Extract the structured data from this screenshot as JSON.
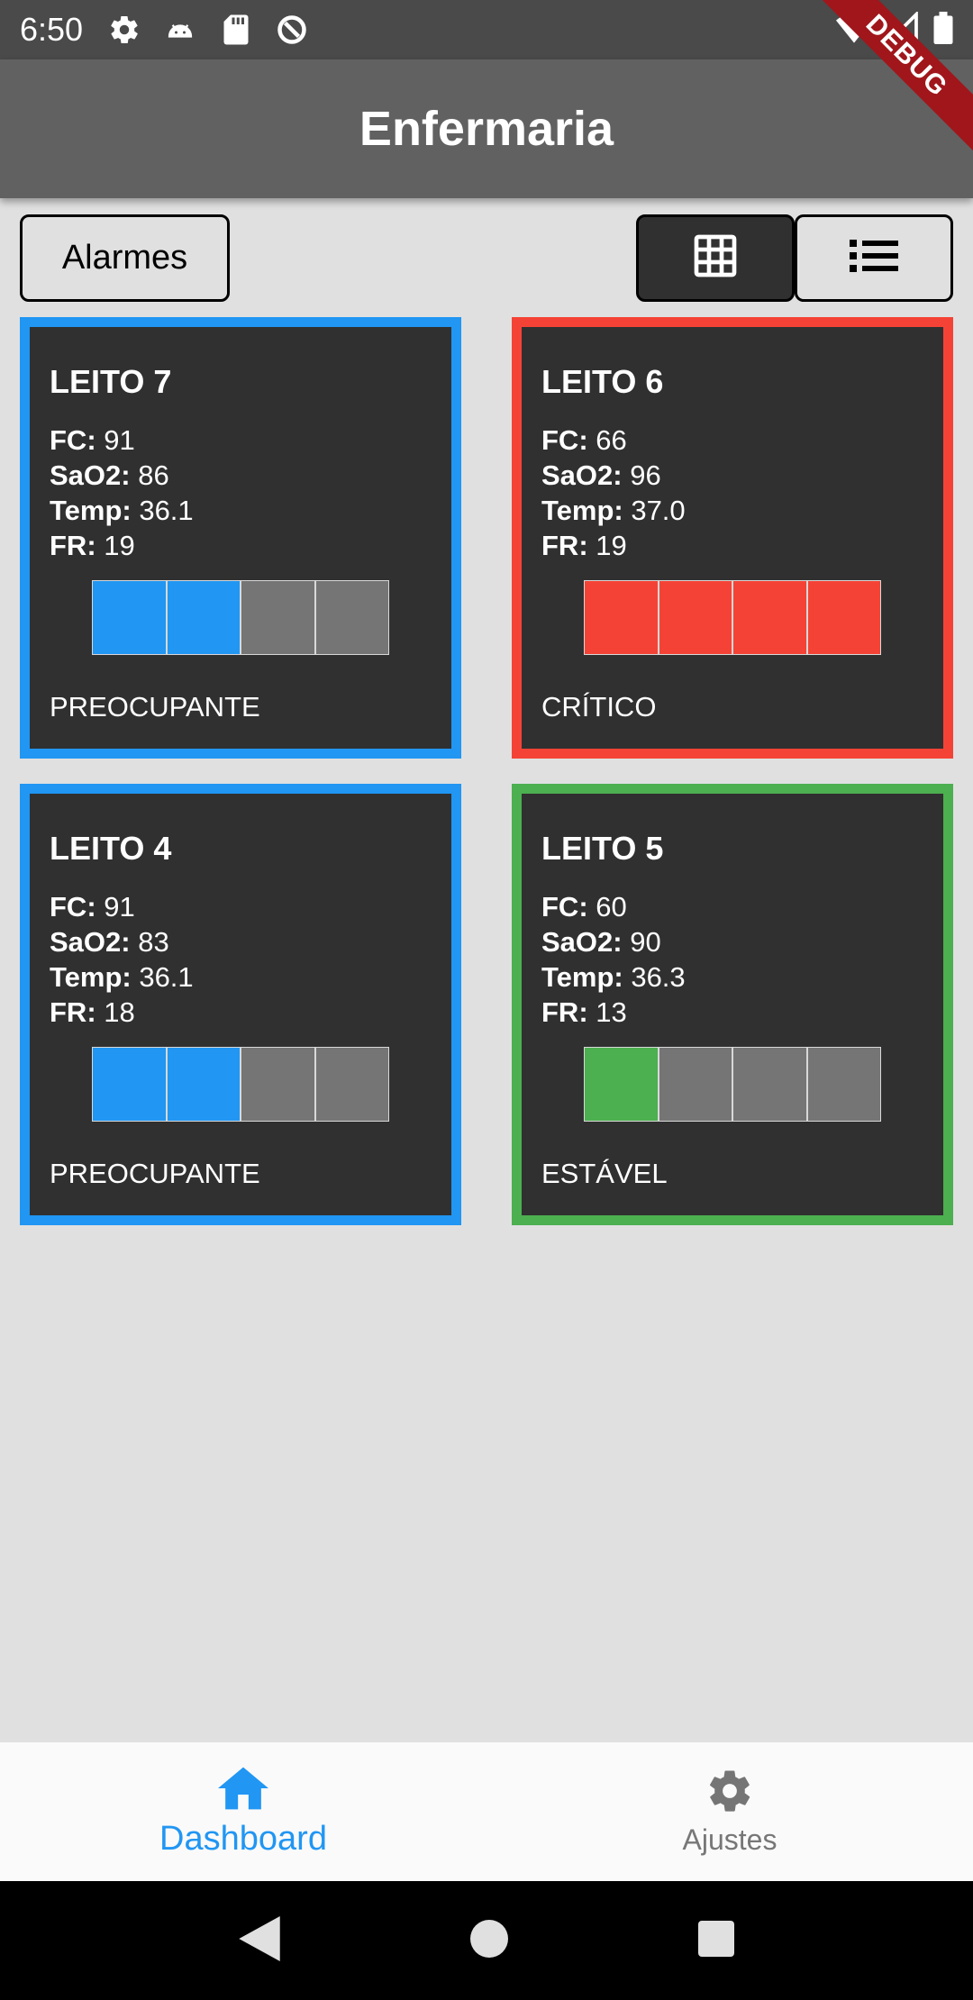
{
  "status_bar": {
    "time": "6:50",
    "icons": [
      "gear-icon",
      "android-icon",
      "sd-card-icon",
      "sync-icon"
    ],
    "right_icons": [
      "wifi-icon",
      "signal-icon",
      "battery-icon"
    ]
  },
  "debug_banner": "DEBUG",
  "app_bar": {
    "title": "Enfermaria"
  },
  "controls": {
    "alarms_label": "Alarmes",
    "grid_view_icon": "grid-icon",
    "list_view_icon": "list-icon"
  },
  "labels": {
    "fc": "FC:",
    "sao2": "SaO2:",
    "temp": "Temp:",
    "fr": "FR:"
  },
  "colors": {
    "preocupante": "#2196f3",
    "critico": "#f44336",
    "estavel": "#4caf50",
    "inactive_segment": "#757575",
    "card_bg": "#303030"
  },
  "beds": [
    {
      "name": "LEITO 7",
      "fc": "91",
      "sao2": "86",
      "temp": "36.1",
      "fr": "19",
      "status": "PREOCUPANTE",
      "level": 2,
      "color": "#2196f3"
    },
    {
      "name": "LEITO 6",
      "fc": "66",
      "sao2": "96",
      "temp": "37.0",
      "fr": "19",
      "status": "CRÍTICO",
      "level": 4,
      "color": "#f44336"
    },
    {
      "name": "LEITO 4",
      "fc": "91",
      "sao2": "83",
      "temp": "36.1",
      "fr": "18",
      "status": "PREOCUPANTE",
      "level": 2,
      "color": "#2196f3"
    },
    {
      "name": "LEITO 5",
      "fc": "60",
      "sao2": "90",
      "temp": "36.3",
      "fr": "13",
      "status": "ESTÁVEL",
      "level": 1,
      "color": "#4caf50"
    }
  ],
  "bottom_nav": {
    "items": [
      {
        "label": "Dashboard",
        "icon": "home-icon",
        "active": true
      },
      {
        "label": "Ajustes",
        "icon": "gear-icon",
        "active": false
      }
    ]
  },
  "system_nav": [
    "back-icon",
    "home-circle-icon",
    "recents-icon"
  ]
}
